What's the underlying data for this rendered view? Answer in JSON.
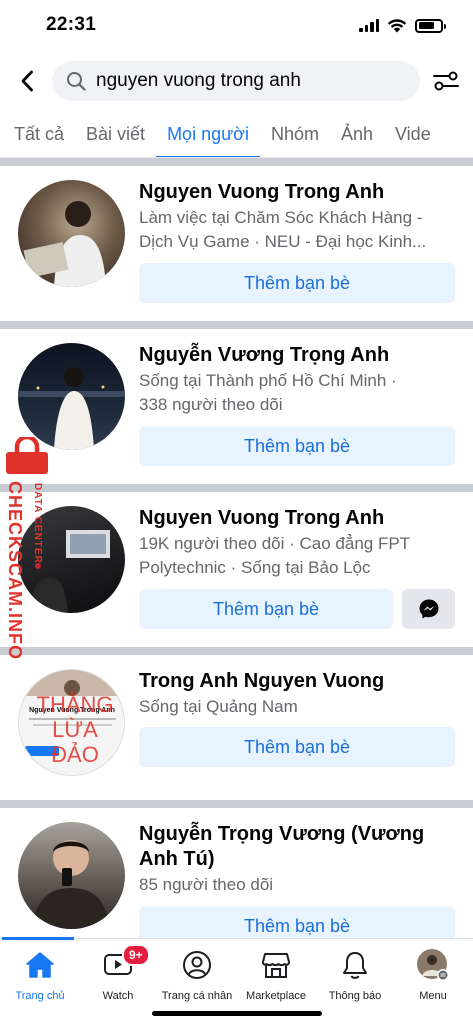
{
  "status": {
    "time": "22:31"
  },
  "search": {
    "query": "nguyen vuong trong anh"
  },
  "tabs": [
    {
      "label": "Tất cả"
    },
    {
      "label": "Bài viết"
    },
    {
      "label": "Mọi người"
    },
    {
      "label": "Nhóm"
    },
    {
      "label": "Ảnh"
    },
    {
      "label": "Vide"
    }
  ],
  "active_tab": "Mọi người",
  "results": [
    {
      "name": "Nguyen Vuong Trong Anh",
      "line1": "Làm việc tại Chăm Sóc Khách Hàng -",
      "line2": "Dịch Vụ Game · NEU - Đại học Kinh...",
      "button": "Thêm bạn bè"
    },
    {
      "name": "Nguyễn Vương Trọng Anh",
      "line1": "Sống tại Thành phố Hồ Chí Minh ·",
      "line2": "338 người theo dõi",
      "button": "Thêm bạn bè"
    },
    {
      "name": "Nguyen Vuong Trong Anh",
      "line1": "19K người theo dõi · Cao đẳng FPT",
      "line2": "Polytechnic · Sống tại Bảo Lộc",
      "button": "Thêm bạn bè"
    },
    {
      "name": "Trong Anh Nguyen Vuong",
      "line1": "Sống tại Quảng Nam",
      "button": "Thêm bạn bè",
      "avatar_caption": "Nguyen Vuong Trong Anh"
    },
    {
      "name": "Nguyễn Trọng Vương (Vương",
      "name2": "Anh Tú)",
      "line1": "85 người theo dõi",
      "button": "Thêm bạn bè"
    }
  ],
  "watermark": {
    "main": "CHECKSCAM.INFO",
    "small": "DATA CENTER",
    "stamp1": "THẰNG",
    "stamp2": "LỪA",
    "stamp3": "ĐẢO"
  },
  "nav": [
    {
      "label": "Trang chủ",
      "icon": "home-icon"
    },
    {
      "label": "Watch",
      "icon": "watch-icon",
      "badge": "9+"
    },
    {
      "label": "Trang cá nhân",
      "icon": "profile-icon"
    },
    {
      "label": "Marketplace",
      "icon": "marketplace-icon"
    },
    {
      "label": "Thông báo",
      "icon": "bell-icon"
    },
    {
      "label": "Menu",
      "icon": "menu-avatar-icon"
    }
  ],
  "colors": {
    "accent": "#1877f2",
    "button_bg": "#e7f3ff",
    "watermark": "#e0312b",
    "badge": "#e41e3f"
  }
}
